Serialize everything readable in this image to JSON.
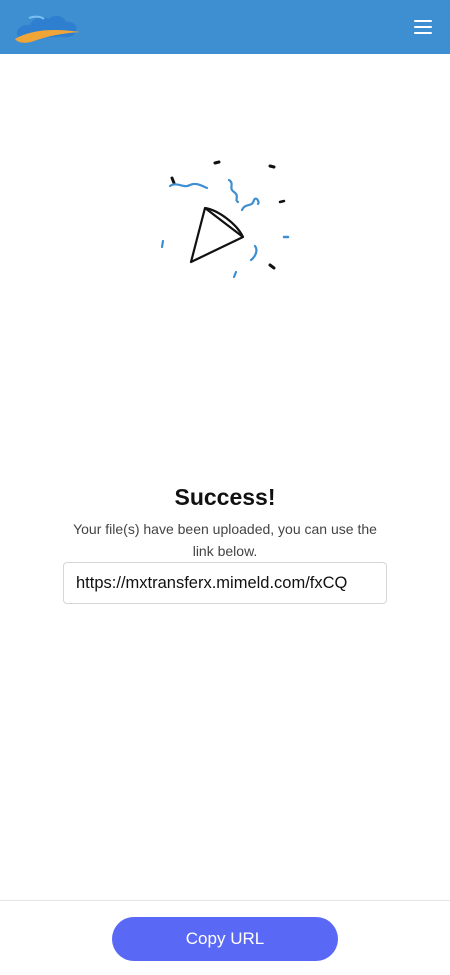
{
  "header": {
    "logo_icon": "cloud-logo-icon",
    "menu_icon": "hamburger-menu-icon",
    "background_color": "#3d8fd1"
  },
  "main": {
    "illustration_icon": "party-popper-icon",
    "title": "Success!",
    "message": "Your file(s) have been uploaded, you can use the link below.",
    "url_value": "https://mxtransferx.mimeld.com/fxCQ"
  },
  "footer": {
    "copy_button_label": "Copy URL",
    "button_color": "#5a68f6"
  }
}
